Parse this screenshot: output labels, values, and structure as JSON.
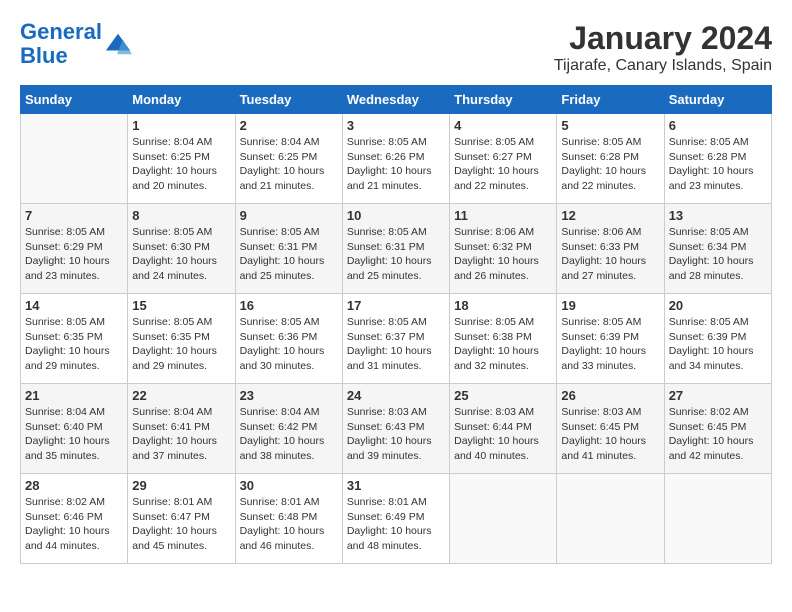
{
  "header": {
    "logo_line1": "General",
    "logo_line2": "Blue",
    "title": "January 2024",
    "subtitle": "Tijarafe, Canary Islands, Spain"
  },
  "days_of_week": [
    "Sunday",
    "Monday",
    "Tuesday",
    "Wednesday",
    "Thursday",
    "Friday",
    "Saturday"
  ],
  "weeks": [
    [
      {
        "day": "",
        "info": ""
      },
      {
        "day": "1",
        "info": "Sunrise: 8:04 AM\nSunset: 6:25 PM\nDaylight: 10 hours\nand 20 minutes."
      },
      {
        "day": "2",
        "info": "Sunrise: 8:04 AM\nSunset: 6:25 PM\nDaylight: 10 hours\nand 21 minutes."
      },
      {
        "day": "3",
        "info": "Sunrise: 8:05 AM\nSunset: 6:26 PM\nDaylight: 10 hours\nand 21 minutes."
      },
      {
        "day": "4",
        "info": "Sunrise: 8:05 AM\nSunset: 6:27 PM\nDaylight: 10 hours\nand 22 minutes."
      },
      {
        "day": "5",
        "info": "Sunrise: 8:05 AM\nSunset: 6:28 PM\nDaylight: 10 hours\nand 22 minutes."
      },
      {
        "day": "6",
        "info": "Sunrise: 8:05 AM\nSunset: 6:28 PM\nDaylight: 10 hours\nand 23 minutes."
      }
    ],
    [
      {
        "day": "7",
        "info": "Sunrise: 8:05 AM\nSunset: 6:29 PM\nDaylight: 10 hours\nand 23 minutes."
      },
      {
        "day": "8",
        "info": "Sunrise: 8:05 AM\nSunset: 6:30 PM\nDaylight: 10 hours\nand 24 minutes."
      },
      {
        "day": "9",
        "info": "Sunrise: 8:05 AM\nSunset: 6:31 PM\nDaylight: 10 hours\nand 25 minutes."
      },
      {
        "day": "10",
        "info": "Sunrise: 8:05 AM\nSunset: 6:31 PM\nDaylight: 10 hours\nand 25 minutes."
      },
      {
        "day": "11",
        "info": "Sunrise: 8:06 AM\nSunset: 6:32 PM\nDaylight: 10 hours\nand 26 minutes."
      },
      {
        "day": "12",
        "info": "Sunrise: 8:06 AM\nSunset: 6:33 PM\nDaylight: 10 hours\nand 27 minutes."
      },
      {
        "day": "13",
        "info": "Sunrise: 8:05 AM\nSunset: 6:34 PM\nDaylight: 10 hours\nand 28 minutes."
      }
    ],
    [
      {
        "day": "14",
        "info": "Sunrise: 8:05 AM\nSunset: 6:35 PM\nDaylight: 10 hours\nand 29 minutes."
      },
      {
        "day": "15",
        "info": "Sunrise: 8:05 AM\nSunset: 6:35 PM\nDaylight: 10 hours\nand 29 minutes."
      },
      {
        "day": "16",
        "info": "Sunrise: 8:05 AM\nSunset: 6:36 PM\nDaylight: 10 hours\nand 30 minutes."
      },
      {
        "day": "17",
        "info": "Sunrise: 8:05 AM\nSunset: 6:37 PM\nDaylight: 10 hours\nand 31 minutes."
      },
      {
        "day": "18",
        "info": "Sunrise: 8:05 AM\nSunset: 6:38 PM\nDaylight: 10 hours\nand 32 minutes."
      },
      {
        "day": "19",
        "info": "Sunrise: 8:05 AM\nSunset: 6:39 PM\nDaylight: 10 hours\nand 33 minutes."
      },
      {
        "day": "20",
        "info": "Sunrise: 8:05 AM\nSunset: 6:39 PM\nDaylight: 10 hours\nand 34 minutes."
      }
    ],
    [
      {
        "day": "21",
        "info": "Sunrise: 8:04 AM\nSunset: 6:40 PM\nDaylight: 10 hours\nand 35 minutes."
      },
      {
        "day": "22",
        "info": "Sunrise: 8:04 AM\nSunset: 6:41 PM\nDaylight: 10 hours\nand 37 minutes."
      },
      {
        "day": "23",
        "info": "Sunrise: 8:04 AM\nSunset: 6:42 PM\nDaylight: 10 hours\nand 38 minutes."
      },
      {
        "day": "24",
        "info": "Sunrise: 8:03 AM\nSunset: 6:43 PM\nDaylight: 10 hours\nand 39 minutes."
      },
      {
        "day": "25",
        "info": "Sunrise: 8:03 AM\nSunset: 6:44 PM\nDaylight: 10 hours\nand 40 minutes."
      },
      {
        "day": "26",
        "info": "Sunrise: 8:03 AM\nSunset: 6:45 PM\nDaylight: 10 hours\nand 41 minutes."
      },
      {
        "day": "27",
        "info": "Sunrise: 8:02 AM\nSunset: 6:45 PM\nDaylight: 10 hours\nand 42 minutes."
      }
    ],
    [
      {
        "day": "28",
        "info": "Sunrise: 8:02 AM\nSunset: 6:46 PM\nDaylight: 10 hours\nand 44 minutes."
      },
      {
        "day": "29",
        "info": "Sunrise: 8:01 AM\nSunset: 6:47 PM\nDaylight: 10 hours\nand 45 minutes."
      },
      {
        "day": "30",
        "info": "Sunrise: 8:01 AM\nSunset: 6:48 PM\nDaylight: 10 hours\nand 46 minutes."
      },
      {
        "day": "31",
        "info": "Sunrise: 8:01 AM\nSunset: 6:49 PM\nDaylight: 10 hours\nand 48 minutes."
      },
      {
        "day": "",
        "info": ""
      },
      {
        "day": "",
        "info": ""
      },
      {
        "day": "",
        "info": ""
      }
    ]
  ]
}
